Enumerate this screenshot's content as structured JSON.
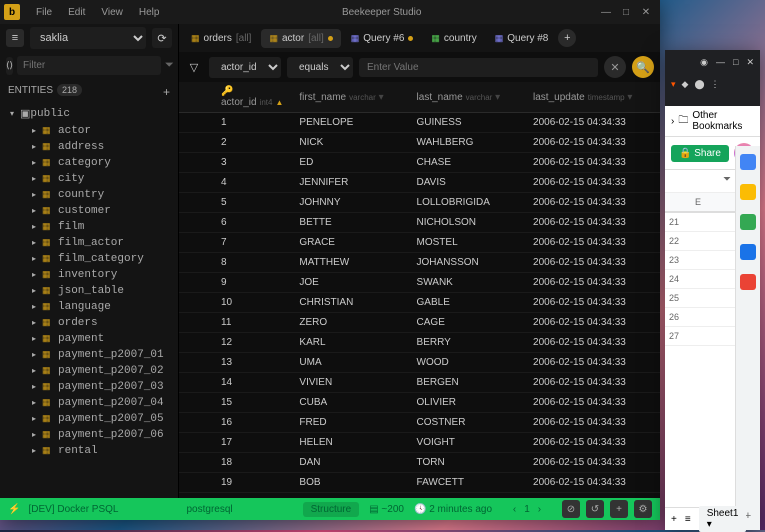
{
  "app": {
    "title": "Beekeeper Studio"
  },
  "menu": [
    "File",
    "Edit",
    "View",
    "Help"
  ],
  "db": {
    "name": "saklia"
  },
  "filter": {
    "placeholder": "Filter"
  },
  "entities": {
    "label": "ENTITIES",
    "count": "218"
  },
  "schema": {
    "name": "public"
  },
  "tables": [
    "actor",
    "address",
    "category",
    "city",
    "country",
    "customer",
    "film",
    "film_actor",
    "film_category",
    "inventory",
    "json_table",
    "language",
    "orders",
    "payment",
    "payment_p2007_01",
    "payment_p2007_02",
    "payment_p2007_03",
    "payment_p2007_04",
    "payment_p2007_05",
    "payment_p2007_06",
    "rental"
  ],
  "tabs": [
    {
      "icon": "orders",
      "label": "orders",
      "suffix": "[all]"
    },
    {
      "icon": "actor",
      "label": "actor",
      "suffix": "[all]",
      "dot": true,
      "active": true
    },
    {
      "icon": "query",
      "label": "Query #6",
      "dot": true
    },
    {
      "icon": "country",
      "label": "country"
    },
    {
      "icon": "query",
      "label": "Query #8"
    }
  ],
  "filterbar": {
    "col": "actor_id",
    "op": "equals",
    "placeholder": "Enter Value"
  },
  "columns": [
    {
      "name": "actor_id",
      "type": "int4",
      "key": true,
      "sort": "asc"
    },
    {
      "name": "first_name",
      "type": "varchar"
    },
    {
      "name": "last_name",
      "type": "varchar"
    },
    {
      "name": "last_update",
      "type": "timestamp"
    }
  ],
  "rows": [
    {
      "id": "1",
      "first": "PENELOPE",
      "last": "GUINESS",
      "upd": "2006-02-15 04:34:33"
    },
    {
      "id": "2",
      "first": "NICK",
      "last": "WAHLBERG",
      "upd": "2006-02-15 04:34:33"
    },
    {
      "id": "3",
      "first": "ED",
      "last": "CHASE",
      "upd": "2006-02-15 04:34:33"
    },
    {
      "id": "4",
      "first": "JENNIFER",
      "last": "DAVIS",
      "upd": "2006-02-15 04:34:33"
    },
    {
      "id": "5",
      "first": "JOHNNY",
      "last": "LOLLOBRIGIDA",
      "upd": "2006-02-15 04:34:33"
    },
    {
      "id": "6",
      "first": "BETTE",
      "last": "NICHOLSON",
      "upd": "2006-02-15 04:34:33"
    },
    {
      "id": "7",
      "first": "GRACE",
      "last": "MOSTEL",
      "upd": "2006-02-15 04:34:33"
    },
    {
      "id": "8",
      "first": "MATTHEW",
      "last": "JOHANSSON",
      "upd": "2006-02-15 04:34:33"
    },
    {
      "id": "9",
      "first": "JOE",
      "last": "SWANK",
      "upd": "2006-02-15 04:34:33"
    },
    {
      "id": "10",
      "first": "CHRISTIAN",
      "last": "GABLE",
      "upd": "2006-02-15 04:34:33"
    },
    {
      "id": "11",
      "first": "ZERO",
      "last": "CAGE",
      "upd": "2006-02-15 04:34:33"
    },
    {
      "id": "12",
      "first": "KARL",
      "last": "BERRY",
      "upd": "2006-02-15 04:34:33"
    },
    {
      "id": "13",
      "first": "UMA",
      "last": "WOOD",
      "upd": "2006-02-15 04:34:33"
    },
    {
      "id": "14",
      "first": "VIVIEN",
      "last": "BERGEN",
      "upd": "2006-02-15 04:34:33"
    },
    {
      "id": "15",
      "first": "CUBA",
      "last": "OLIVIER",
      "upd": "2006-02-15 04:34:33"
    },
    {
      "id": "16",
      "first": "FRED",
      "last": "COSTNER",
      "upd": "2006-02-15 04:34:33"
    },
    {
      "id": "17",
      "first": "HELEN",
      "last": "VOIGHT",
      "upd": "2006-02-15 04:34:33"
    },
    {
      "id": "18",
      "first": "DAN",
      "last": "TORN",
      "upd": "2006-02-15 04:34:33"
    },
    {
      "id": "19",
      "first": "BOB",
      "last": "FAWCETT",
      "upd": "2006-02-15 04:34:33"
    }
  ],
  "status": {
    "conn": "[DEV] Docker PSQL",
    "driver": "postgresql",
    "structure": "Structure",
    "rowcount": "~200",
    "time": "2 minutes ago",
    "page": "1"
  },
  "browser": {
    "bookmarks": "Other Bookmarks",
    "share": "Share",
    "sheet": "Sheet1",
    "colE": "E",
    "ss_rows": [
      "21",
      "22",
      "23",
      "24",
      "25",
      "26",
      "27"
    ]
  }
}
